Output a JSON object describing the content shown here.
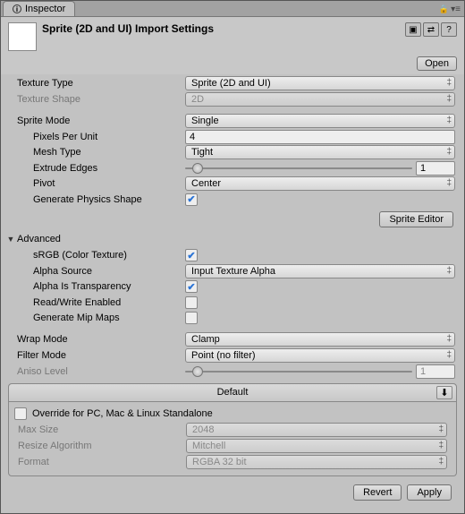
{
  "tab": {
    "title": "Inspector"
  },
  "header": {
    "title": "Sprite (2D and UI) Import Settings",
    "open_label": "Open"
  },
  "textureType": {
    "label": "Texture Type",
    "value": "Sprite (2D and UI)"
  },
  "textureShape": {
    "label": "Texture Shape",
    "value": "2D"
  },
  "spriteMode": {
    "label": "Sprite Mode",
    "value": "Single"
  },
  "pixelsPerUnit": {
    "label": "Pixels Per Unit",
    "value": "4"
  },
  "meshType": {
    "label": "Mesh Type",
    "value": "Tight"
  },
  "extrudeEdges": {
    "label": "Extrude Edges",
    "value": "1",
    "pos": 0.03
  },
  "pivot": {
    "label": "Pivot",
    "value": "Center"
  },
  "genPhysics": {
    "label": "Generate Physics Shape",
    "checked": true
  },
  "spriteEditorBtn": "Sprite Editor",
  "advanced": {
    "label": "Advanced"
  },
  "srgb": {
    "label": "sRGB (Color Texture)",
    "checked": true
  },
  "alphaSource": {
    "label": "Alpha Source",
    "value": "Input Texture Alpha"
  },
  "alphaIsTrans": {
    "label": "Alpha Is Transparency",
    "checked": true
  },
  "readWrite": {
    "label": "Read/Write Enabled",
    "checked": false
  },
  "genMip": {
    "label": "Generate Mip Maps",
    "checked": false
  },
  "wrapMode": {
    "label": "Wrap Mode",
    "value": "Clamp"
  },
  "filterMode": {
    "label": "Filter Mode",
    "value": "Point (no filter)"
  },
  "aniso": {
    "label": "Aniso Level",
    "value": "1",
    "pos": 0.03
  },
  "platform": {
    "defaultTab": "Default",
    "override": {
      "label": "Override for PC, Mac & Linux Standalone",
      "checked": false
    },
    "maxSize": {
      "label": "Max Size",
      "value": "2048"
    },
    "resize": {
      "label": "Resize Algorithm",
      "value": "Mitchell"
    },
    "format": {
      "label": "Format",
      "value": "RGBA 32 bit"
    }
  },
  "footer": {
    "revert": "Revert",
    "apply": "Apply"
  }
}
